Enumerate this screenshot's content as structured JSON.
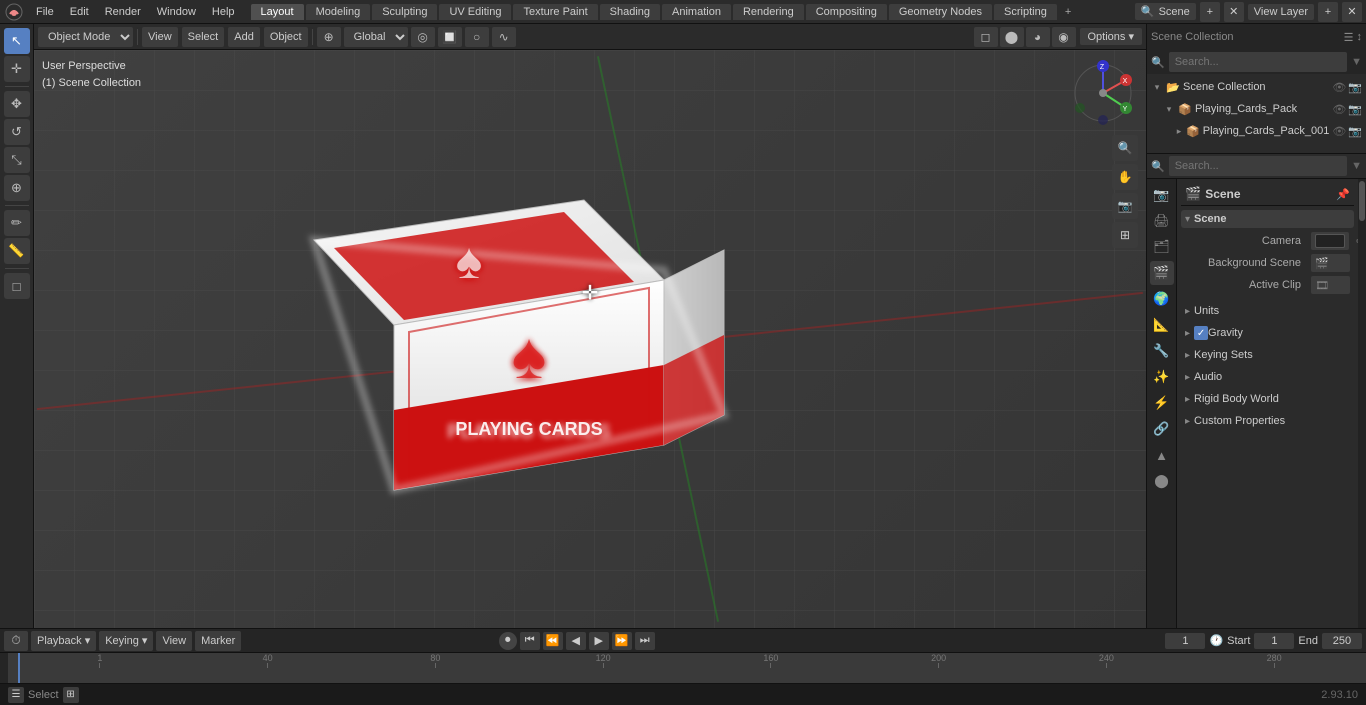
{
  "app": {
    "title": "Blender",
    "version": "2.93.10"
  },
  "topMenu": {
    "items": [
      "Blender",
      "File",
      "Edit",
      "Render",
      "Window",
      "Help"
    ]
  },
  "workspaceTabs": {
    "tabs": [
      "Layout",
      "Modeling",
      "Sculpting",
      "UV Editing",
      "Texture Paint",
      "Shading",
      "Animation",
      "Rendering",
      "Compositing",
      "Geometry Nodes",
      "Scripting"
    ],
    "activeTab": "Layout",
    "addLabel": "+"
  },
  "topRight": {
    "sceneLabel": "Scene",
    "viewLayerLabel": "View Layer"
  },
  "viewportHeader": {
    "modeLabel": "Object Mode",
    "viewLabel": "View",
    "selectLabel": "Select",
    "addLabel": "Add",
    "objectLabel": "Object",
    "transformLabel": "Global",
    "optionsLabel": "Options ▾"
  },
  "viewportInfo": {
    "line1": "User Perspective",
    "line2": "(1) Scene Collection"
  },
  "outliner": {
    "title": "Scene Collection",
    "searchPlaceholder": "Search...",
    "items": [
      {
        "name": "Playing_Cards_Pack",
        "indent": 0,
        "expanded": true,
        "icon": "📦",
        "hasChildren": true
      },
      {
        "name": "Playing_Cards_Pack_001",
        "indent": 1,
        "expanded": false,
        "icon": "📦",
        "hasChildren": true
      }
    ]
  },
  "propertiesPanel": {
    "searchPlaceholder": "Search...",
    "tabs": [
      "render",
      "output",
      "view-layer",
      "scene",
      "world",
      "object",
      "modifier",
      "particles",
      "physics",
      "constraints",
      "data",
      "material",
      "nodes"
    ],
    "activeTab": "scene",
    "sceneLabel": "Scene",
    "sceneName": "Scene",
    "sections": {
      "scene": {
        "label": "Scene",
        "cameraLabel": "Camera",
        "cameraValue": "",
        "backgroundSceneLabel": "Background Scene",
        "backgroundSceneValue": "",
        "activeClipLabel": "Active Clip",
        "activeClipValue": ""
      },
      "units": {
        "label": "Units"
      },
      "gravity": {
        "label": "Gravity",
        "checked": true
      },
      "keyingSets": {
        "label": "Keying Sets"
      },
      "audio": {
        "label": "Audio"
      },
      "rigidBodyWorld": {
        "label": "Rigid Body World"
      },
      "customProperties": {
        "label": "Custom Properties"
      }
    }
  },
  "timeline": {
    "playbackLabel": "Playback",
    "keyingLabel": "Keying",
    "viewLabel": "View",
    "markerLabel": "Marker",
    "currentFrame": "1",
    "startLabel": "Start",
    "startFrame": "1",
    "endLabel": "End",
    "endFrame": "250",
    "frameMarkers": [
      "1",
      "40",
      "80",
      "120",
      "160",
      "200",
      "240",
      "280"
    ],
    "transportButtons": [
      "⏮",
      "⏪",
      "⏴",
      "⏵",
      "⏩",
      "⏭"
    ]
  },
  "statusBar": {
    "selectLabel": "Select",
    "version": "2.93.10"
  }
}
